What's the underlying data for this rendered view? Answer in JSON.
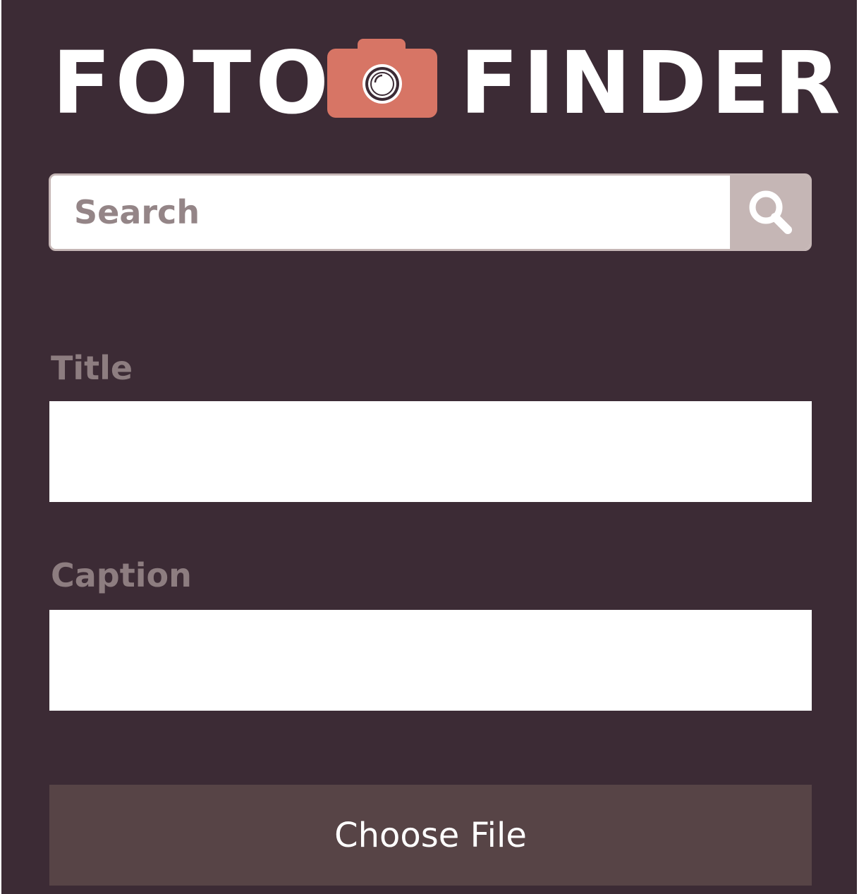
{
  "app": {
    "logo_left": "FOTO",
    "logo_right": "FINDER",
    "logo_icon": "camera-icon"
  },
  "search": {
    "placeholder": "Search",
    "value": "",
    "icon": "search-icon"
  },
  "form": {
    "title_label": "Title",
    "title_value": "",
    "caption_label": "Caption",
    "caption_value": "",
    "choose_file_label": "Choose File"
  },
  "colors": {
    "background": "#3c2b35",
    "accent": "#d77565",
    "search_button": "#c5b6b5",
    "label_text": "#8d7d80",
    "file_button": "#574446"
  }
}
